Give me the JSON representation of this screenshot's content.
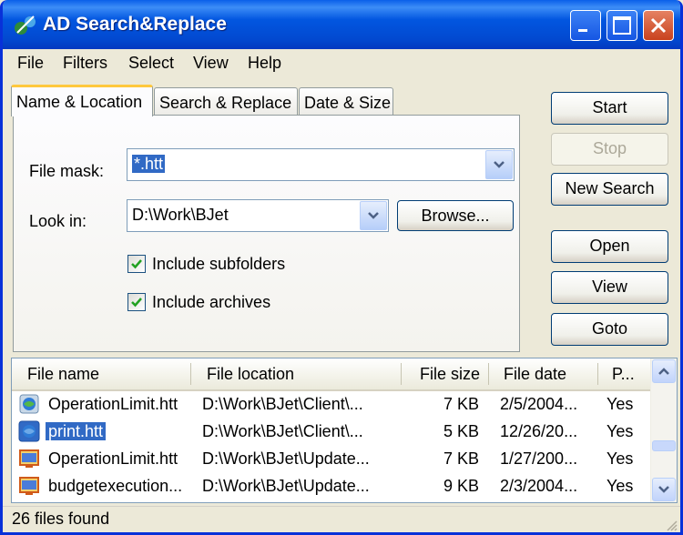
{
  "window": {
    "title": "AD Search&Replace",
    "icon": "app-icon",
    "controls": [
      "minimize-icon",
      "maximize-icon",
      "close-icon"
    ]
  },
  "menu": [
    {
      "label": "File"
    },
    {
      "label": "Filters"
    },
    {
      "label": "Select"
    },
    {
      "label": "View"
    },
    {
      "label": "Help"
    }
  ],
  "tabs": [
    {
      "label": "Name & Location",
      "active": true
    },
    {
      "label": "Search & Replace",
      "active": false
    },
    {
      "label": "Date & Size",
      "active": false
    }
  ],
  "form": {
    "file_mask_label": "File mask:",
    "file_mask_value": "*.htt",
    "look_in_label": "Look in:",
    "look_in_value": "D:\\Work\\BJet",
    "browse_label": "Browse...",
    "include_subfolders_label": "Include subfolders",
    "include_subfolders_checked": true,
    "include_archives_label": "Include archives",
    "include_archives_checked": true
  },
  "buttons": {
    "start": "Start",
    "stop": "Stop",
    "new_search": "New Search",
    "open": "Open",
    "view": "View",
    "goto": "Goto"
  },
  "results": {
    "columns": [
      "File name",
      "File location",
      "File size",
      "File date",
      "P..."
    ],
    "rows": [
      {
        "name": "OperationLimit.htt",
        "location": "D:\\Work\\BJet\\Client\\...",
        "size": "7 KB",
        "date": "2/5/2004...",
        "p": "Yes",
        "icon": "web-file-icon",
        "selected": false
      },
      {
        "name": "print.htt",
        "location": "D:\\Work\\BJet\\Client\\...",
        "size": "5 KB",
        "date": "12/26/20...",
        "p": "Yes",
        "icon": "web-file-icon",
        "selected": true
      },
      {
        "name": "OperationLimit.htt",
        "location": "D:\\Work\\BJet\\Update...",
        "size": "7 KB",
        "date": "1/27/200...",
        "p": "Yes",
        "icon": "window-file-icon",
        "selected": false
      },
      {
        "name": "budgetexecution...",
        "location": "D:\\Work\\BJet\\Update...",
        "size": "9 KB",
        "date": "2/3/2004...",
        "p": "Yes",
        "icon": "window-file-icon",
        "selected": false
      }
    ]
  },
  "status": {
    "text": "26 files found"
  },
  "colors": {
    "titlebar": "#0256E0",
    "selection": "#316AC5",
    "face": "#ECE9D8",
    "close": "#C9421E"
  }
}
